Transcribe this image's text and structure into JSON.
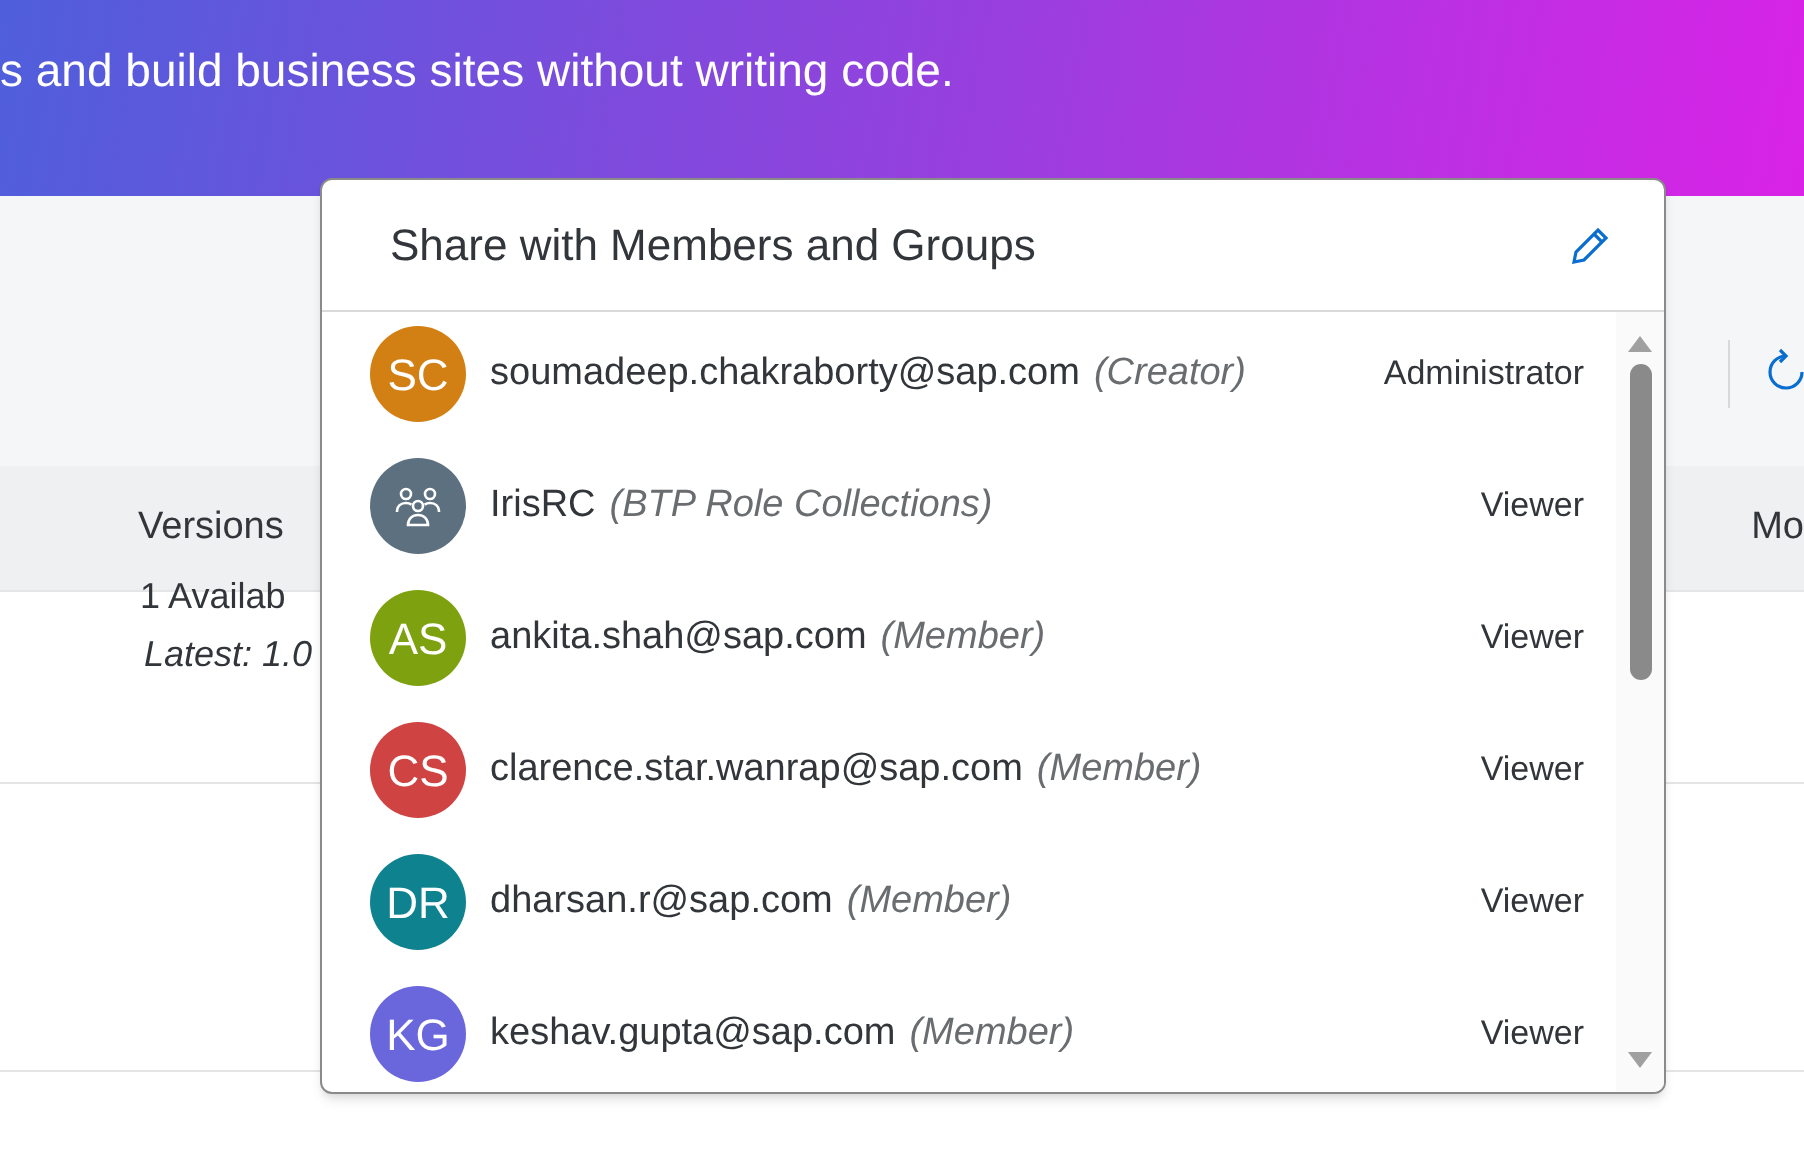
{
  "banner": {
    "subtitle": "s and build business sites without writing code."
  },
  "tabs": [
    "Versions",
    "Mo"
  ],
  "content": {
    "availability": "1 Availab",
    "latest": "Latest: 1.0"
  },
  "share_popover": {
    "title": "Share with Members and Groups",
    "members": [
      {
        "kind": "user",
        "initials": "SC",
        "color": "#d27f14",
        "name": "soumadeep.chakraborty@sap.com",
        "role_note": "(Creator)",
        "permission": "Administrator"
      },
      {
        "kind": "group",
        "color": "#5d7080",
        "name": "IrisRC",
        "role_note": "(BTP Role Collections)",
        "permission": "Viewer"
      },
      {
        "kind": "user",
        "initials": "AS",
        "color": "#7ea10f",
        "name": "ankita.shah@sap.com",
        "role_note": "(Member)",
        "permission": "Viewer"
      },
      {
        "kind": "user",
        "initials": "CS",
        "color": "#d04343",
        "name": "clarence.star.wanrap@sap.com",
        "role_note": "(Member)",
        "permission": "Viewer"
      },
      {
        "kind": "user",
        "initials": "DR",
        "color": "#0e828f",
        "name": "dharsan.r@sap.com",
        "role_note": "(Member)",
        "permission": "Viewer"
      },
      {
        "kind": "user",
        "initials": "KG",
        "color": "#6a67dd",
        "name": "keshav.gupta@sap.com",
        "role_note": "(Member)",
        "permission": "Viewer"
      }
    ]
  }
}
